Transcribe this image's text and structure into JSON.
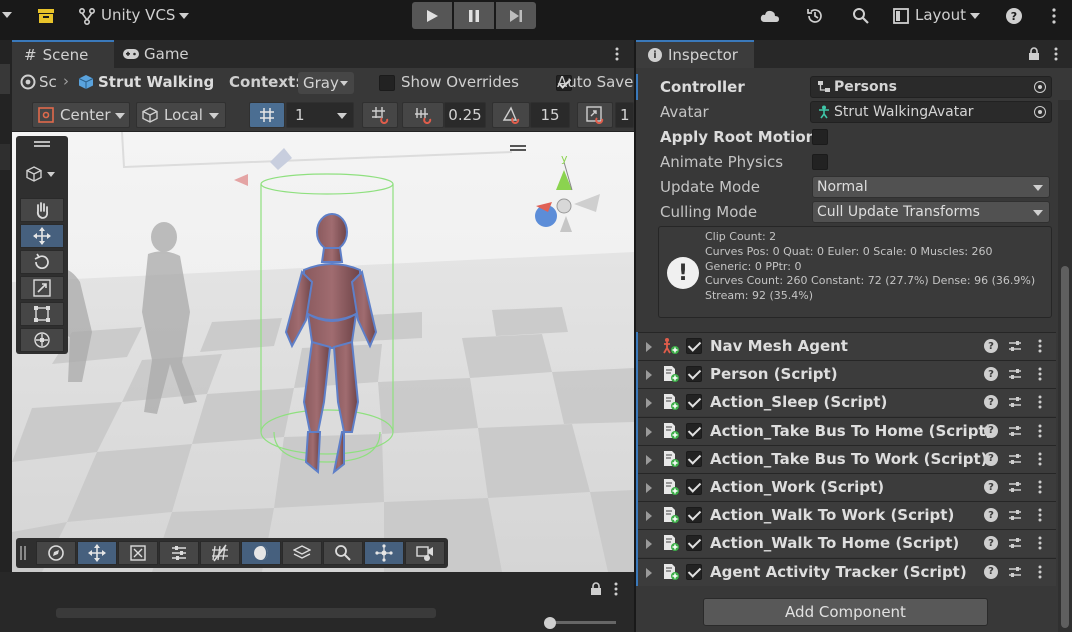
{
  "toolbar": {
    "vcs_label": "Unity VCS",
    "layout_label": "Layout"
  },
  "scene": {
    "tabs": [
      {
        "label": "Scene"
      },
      {
        "label": "Game"
      }
    ],
    "breadcrumb_root": "Sc",
    "breadcrumb_object": "Strut Walking",
    "context_label": "Context:",
    "context_value": "Gray",
    "show_overrides_label": "Show Overrides",
    "auto_save_label": "Auto Save",
    "pivot": "Center",
    "space": "Local",
    "grid_value": "1",
    "snap_move": "0.25",
    "snap_rotate": "15",
    "snap_scale": "1",
    "gizmo_axis": "y"
  },
  "inspector": {
    "tab_label": "Inspector",
    "controller_label": "Controller",
    "controller_value": "Persons",
    "avatar_label": "Avatar",
    "avatar_value": "Strut WalkingAvatar",
    "apply_root_motion_label": "Apply Root Motion",
    "animate_physics_label": "Animate Physics",
    "update_mode_label": "Update Mode",
    "update_mode_value": "Normal",
    "culling_mode_label": "Culling Mode",
    "culling_mode_value": "Cull Update Transforms",
    "info": [
      "Clip Count: 2",
      "Curves Pos: 0 Quat: 0 Euler: 0 Scale: 0 Muscles: 260",
      "Generic: 0 PPtr: 0",
      "Curves Count: 260 Constant: 72 (27.7%) Dense: 96 (36.9%)",
      "Stream: 92 (35.4%)"
    ],
    "components": [
      {
        "name": "Nav Mesh Agent"
      },
      {
        "name": "Person (Script)"
      },
      {
        "name": "Action_Sleep (Script)"
      },
      {
        "name": "Action_Take Bus To Home (Script)"
      },
      {
        "name": "Action_Take Bus To Work (Script)"
      },
      {
        "name": "Action_Work (Script)"
      },
      {
        "name": "Action_Walk To Work (Script)"
      },
      {
        "name": "Action_Walk To Home (Script)"
      },
      {
        "name": "Agent Activity Tracker (Script)"
      }
    ],
    "add_component_label": "Add Component"
  },
  "colors": {
    "accent": "#3a79bb",
    "panel": "#383838",
    "background": "#191919"
  }
}
